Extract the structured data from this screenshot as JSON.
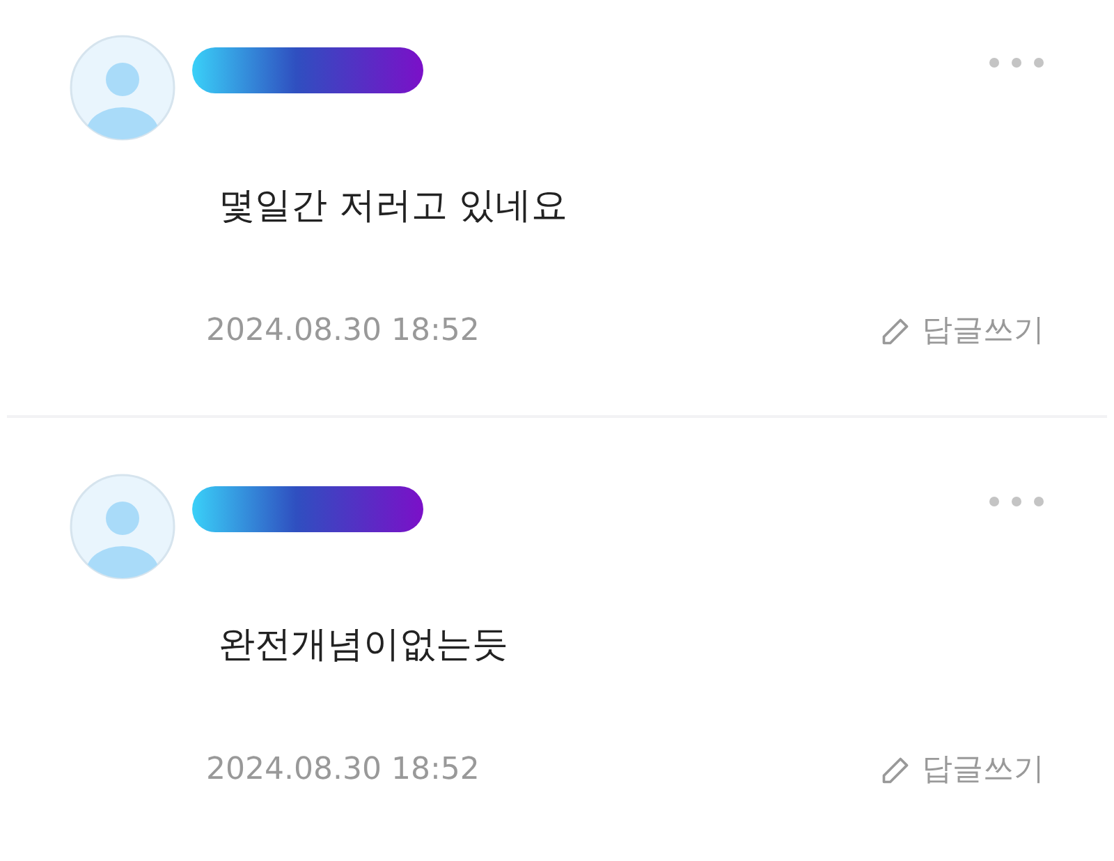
{
  "comments": [
    {
      "text": "몇일간 저러고 있네요",
      "date": "2024.08.30 18:52",
      "reply_label": "답글쓰기"
    },
    {
      "text": "완전개념이없는듯",
      "date": "2024.08.30 18:52",
      "reply_label": "답글쓰기"
    }
  ]
}
